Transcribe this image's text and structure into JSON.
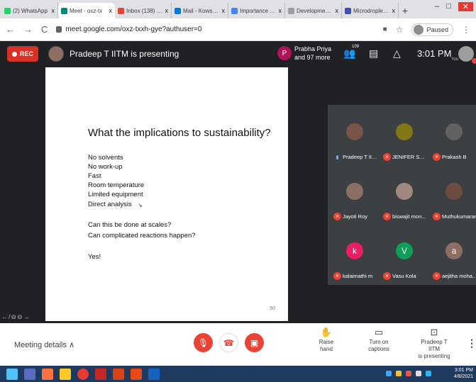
{
  "browser": {
    "tabs": [
      {
        "title": "(2) WhatsApp",
        "color": "#25d366",
        "active": false
      },
      {
        "title": "Meet - oxz-tx",
        "color": "#00897b",
        "active": true
      },
      {
        "title": "Inbox (138) - kow",
        "color": "#ea4335",
        "active": false
      },
      {
        "title": "Mail - Kowshalya",
        "color": "#0078d4",
        "active": false
      },
      {
        "title": "Importance of mi",
        "color": "#4285f4",
        "active": false
      },
      {
        "title": "Development of",
        "color": "#9e9e9e",
        "active": false
      },
      {
        "title": "Microdroplets in",
        "color": "#3f51b5",
        "active": false
      }
    ],
    "new_tab": "+",
    "url": "meet.google.com/oxz-txxh-gye?authuser=0",
    "profile_status": "Paused"
  },
  "meet": {
    "rec_label": "REC",
    "presenting_text": "Pradeep T IITM is presenting",
    "pinned_initial": "P",
    "pinned_name": "Prabha Priya",
    "pinned_more": "and 97 more",
    "participant_count": "109",
    "time": "3:01 PM",
    "you_label": "You"
  },
  "slide": {
    "title": "What the implications to sustainability?",
    "lines": [
      "No solvents",
      "No work-up",
      "Fast",
      "Room temperature",
      "Limited equipment",
      "Direct analysis",
      "Can this be done at scales?",
      "Can complicated reactions happen?",
      "Yes!"
    ],
    "page_number": "50",
    "tools": "←/⊖⊖→"
  },
  "participants": [
    {
      "name": "Pradeep T IITM",
      "initial": "",
      "color": "#795548",
      "speaking": true
    },
    {
      "name": "JENIFER SHA...",
      "initial": "",
      "color": "#827717",
      "speaking": false
    },
    {
      "name": "Prakash B",
      "initial": "",
      "color": "#616161",
      "speaking": false
    },
    {
      "name": "Jayoti Roy",
      "initial": "",
      "color": "#8d6e63",
      "speaking": false
    },
    {
      "name": "biswajit mon...",
      "initial": "",
      "color": "#a1887f",
      "speaking": false
    },
    {
      "name": "Muthukumaran",
      "initial": "",
      "color": "#6d4c41",
      "speaking": false
    },
    {
      "name": "kalaimathi m",
      "initial": "k",
      "color": "#e91e63",
      "speaking": false
    },
    {
      "name": "Vasu Kola",
      "initial": "V",
      "color": "#0f9d58",
      "speaking": false
    },
    {
      "name": "aejitha moha...",
      "initial": "a",
      "color": "#8d6e63",
      "speaking": false
    }
  ],
  "controls": {
    "meeting_details": "Meeting details",
    "raise_hand": "Raise hand",
    "captions": "Turn on captions",
    "presenting_line1": "Pradeep T IITM",
    "presenting_line2": "is presenting"
  },
  "taskbar": {
    "time": "3:01 PM",
    "date": "4/8/2021"
  }
}
